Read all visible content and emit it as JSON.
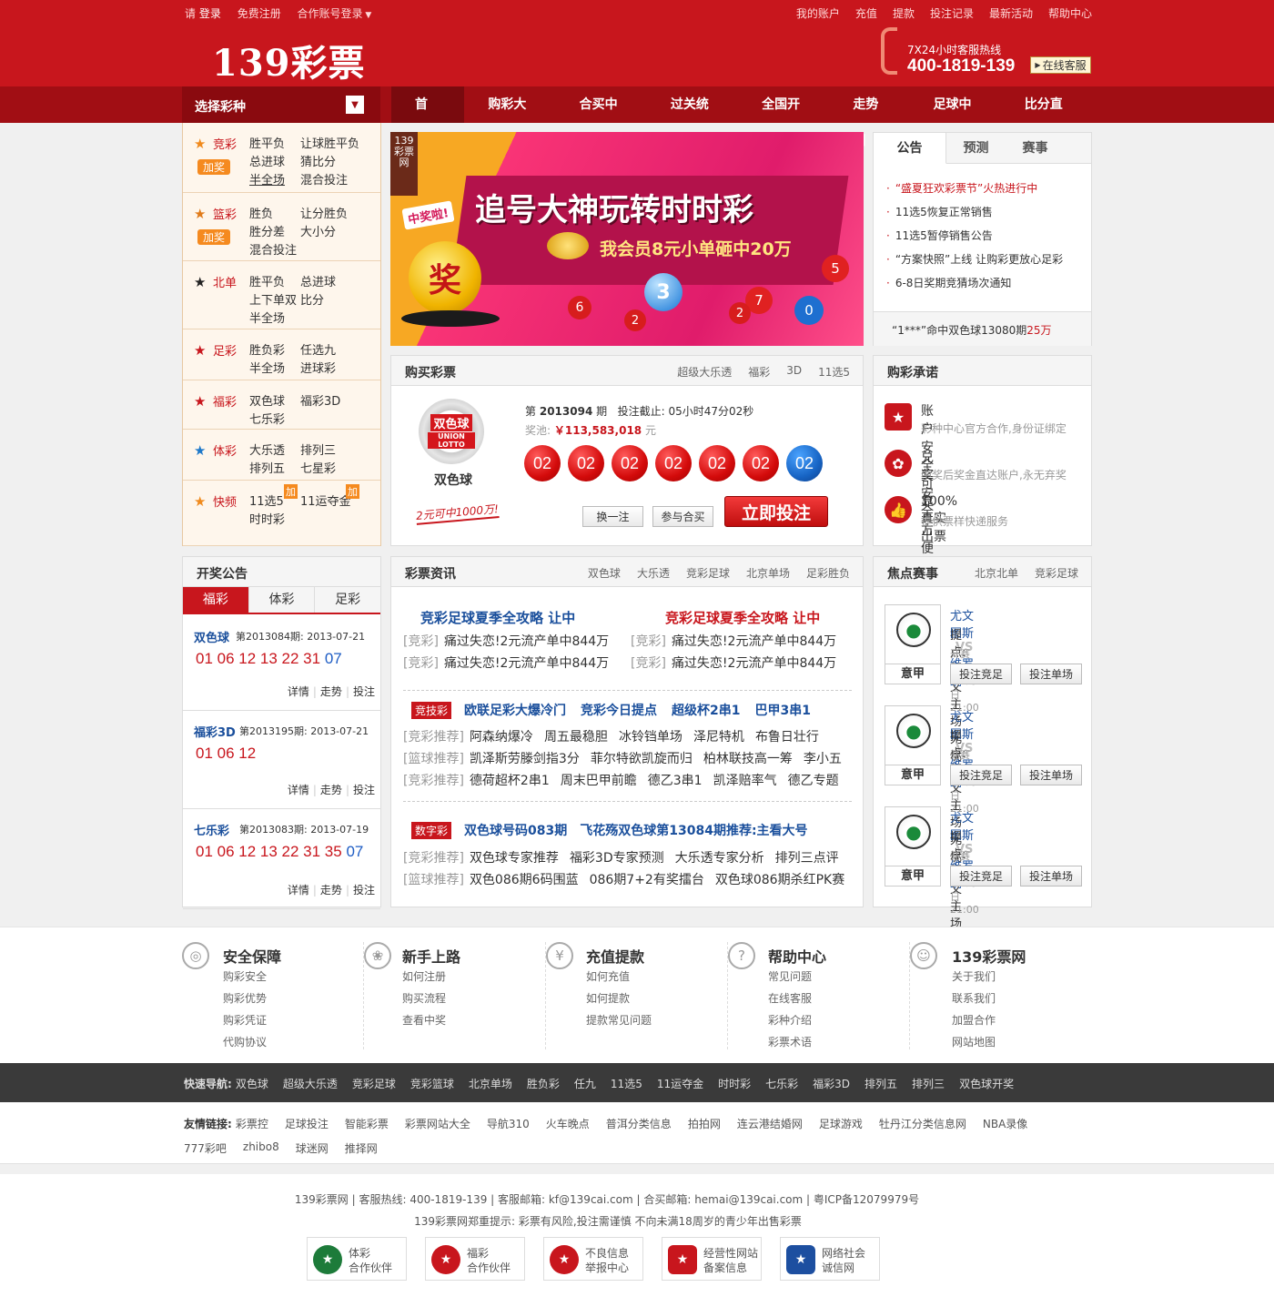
{
  "topbar": {
    "please": "请",
    "login": "登录",
    "register": "免费注册",
    "partner_login": "合作账号登录",
    "right_links": [
      "我的账户",
      "充值",
      "提款",
      "投注记录",
      "最新活动",
      "帮助中心"
    ]
  },
  "logo": "139彩票",
  "hotline": {
    "label": "7X24小时客服热线",
    "number": "400-1819-139",
    "online": "在线客服"
  },
  "nav": {
    "select": "选择彩种",
    "items": [
      "首 页",
      "购彩大厅",
      "合买中心",
      "过关统计",
      "全国开奖",
      "走势图",
      "足球中心",
      "比分直播"
    ]
  },
  "lottery_menu": [
    {
      "name": "竞彩",
      "badge": "加奖",
      "items": [
        "胜平负",
        "让球胜平负",
        "总进球",
        "猜比分",
        "半全场",
        "混合投注"
      ]
    },
    {
      "name": "篮彩",
      "badge": "加奖",
      "items": [
        "胜负",
        "让分胜负",
        "胜分差",
        "大小分",
        "混合投注"
      ]
    },
    {
      "name": "北单",
      "items": [
        "胜平负",
        "总进球",
        "上下单双",
        "比分",
        "半全场"
      ]
    },
    {
      "name": "足彩",
      "items": [
        "胜负彩",
        "任选九",
        "半全场",
        "进球彩"
      ]
    },
    {
      "name": "福彩",
      "items": [
        "双色球",
        "福彩3D",
        "七乐彩"
      ]
    },
    {
      "name": "体彩",
      "items": [
        "大乐透",
        "排列三",
        "排列五",
        "七星彩"
      ]
    },
    {
      "name": "快频",
      "items": [
        "11选5",
        "11运夺金",
        "时时彩"
      ],
      "jia": "加"
    }
  ],
  "banner": {
    "brand": "139彩票网",
    "title": "追号大神玩转时时彩",
    "subtitle": "我会员8元小单砸中20万",
    "tag": "中奖啦!",
    "award": "奖",
    "balls": [
      "6",
      "2",
      "3",
      "7",
      "2",
      "5",
      "0"
    ]
  },
  "notice": {
    "tabs": [
      "公告",
      "预测",
      "赛事"
    ],
    "items": [
      "“盛夏狂欢彩票节”火热进行中",
      "11选5恢复正常销售",
      "11选5暂停销售公告",
      "“方案快照”上线 让购彩更放心足彩",
      "6-8日奖期竞猜场次通知"
    ],
    "winner": "“1***”命中双色球13080期",
    "winner_amount": "25万"
  },
  "buy": {
    "title": "购买彩票",
    "tabs": [
      "超级大乐透",
      "福彩",
      "3D",
      "11选5"
    ],
    "game": "双色球",
    "game_logo": "双色球",
    "game_logo_en": "UNION LOTTO",
    "slogan": "2元可中1000万!",
    "issue_prefix": "第",
    "issue": "2013094",
    "issue_suffix": "期",
    "deadline": "投注截止: 05小时47分02秒",
    "pool_label": "奖池:",
    "pool": "￥113,583,018",
    "pool_unit": "元",
    "reds": [
      "02",
      "02",
      "02",
      "02",
      "02",
      "02"
    ],
    "blue": "02",
    "btn_change": "换一注",
    "btn_join": "参与合买",
    "btn_bet": "立即投注"
  },
  "promise": {
    "title": "购彩承诺",
    "items": [
      {
        "t": "账户安全可靠",
        "d": "彩种中心官方合作,身份证绑定"
      },
      {
        "t": "兑奖安全方便",
        "d": "中奖后奖金直达账户,永无弃奖"
      },
      {
        "t": "100%真实出票",
        "d": "提供票样快递服务"
      }
    ]
  },
  "draw": {
    "title": "开奖公告",
    "tabs": [
      "福彩",
      "体彩",
      "足彩"
    ],
    "items": [
      {
        "name": "双色球",
        "issue": "第2013084期: 2013-07-21",
        "reds": "01 06 12 13 22 31",
        "blue": "07"
      },
      {
        "name": "福彩3D",
        "issue": "第2013195期: 2013-07-21",
        "reds": "01 06 12",
        "blue": ""
      },
      {
        "name": "七乐彩",
        "issue": "第2013083期: 2013-07-19",
        "reds": "01 06 12 13 22 31 35",
        "blue": "07"
      }
    ],
    "links": [
      "详情",
      "走势",
      "投注"
    ]
  },
  "news": {
    "title": "彩票资讯",
    "tabs": [
      "双色球",
      "大乐透",
      "竞彩足球",
      "北京单场",
      "足彩胜负"
    ],
    "head1": "竞彩足球夏季全攻略 让中",
    "head2": "竞彩足球夏季全攻略 让中",
    "tag": "[竞彩]",
    "line": "痛过失恋!2元流产单中844万",
    "sec2_label": "竞技彩",
    "sec2_heads": [
      "欧联足彩大爆冷门",
      "竞彩今日提点",
      "超级杯2串1",
      "巴甲3串1"
    ],
    "sec2_rows": [
      {
        "tag": "[竞彩推荐]",
        "items": [
          "阿森纳爆冷",
          "周五最稳胆",
          "冰铃铛单场",
          "泽尼特机",
          "布鲁日壮行"
        ]
      },
      {
        "tag": "[篮球推荐]",
        "items": [
          "凯泽斯劳滕剑指3分",
          "菲尔特欲凯旋而归",
          "柏林联技高一筹",
          "李小五"
        ]
      },
      {
        "tag": "[竞彩推荐]",
        "items": [
          "德荷超杯2串1",
          "周末巴甲前瞻",
          "德乙3串1",
          "凯泽赔率气",
          "德乙专题"
        ]
      }
    ],
    "sec3_label": "数字彩",
    "sec3_heads": [
      "双色球号码083期",
      "飞花殇双色球第13084期推荐:主看大号"
    ],
    "sec3_rows": [
      {
        "tag": "[竞彩推荐]",
        "items": [
          "双色球专家推荐",
          "福彩3D专家预测",
          "大乐透专家分析",
          "排列三点评"
        ]
      },
      {
        "tag": "[篮球推荐]",
        "items": [
          "双色086期6码围蓝",
          "086期7+2有奖擂台",
          "双色球086期杀红PK赛"
        ]
      }
    ]
  },
  "focus": {
    "title": "焦点赛事",
    "tabs": [
      "北京北单",
      "竞彩足球"
    ],
    "matches": [
      {
        "home": "尤文图斯",
        "vs": "VS",
        "away": "维罗纳",
        "tip": "提点: 尤文主场无忧",
        "time": "开赛 09-22 周日 21:00",
        "league": "意甲",
        "b1": "投注竞足",
        "b2": "投注单场"
      },
      {
        "home": "尤文图斯",
        "vs": "VS",
        "away": "维罗纳",
        "tip": "提点: 尤文主场无忧",
        "time": "开赛 09-22 周日 21:00",
        "league": "意甲",
        "b1": "投注竞足",
        "b2": "投注单场"
      },
      {
        "home": "尤文图斯",
        "vs": "VS",
        "away": "维罗纳",
        "tip": "提点: 尤文主场无忧",
        "time": "开赛 09-22 周日 21:00",
        "league": "意甲",
        "b1": "投注竞足",
        "b2": "投注单场"
      }
    ]
  },
  "help": [
    {
      "t": "安全保障",
      "i": [
        "购彩安全",
        "购彩优势",
        "购彩凭证",
        "代购协议"
      ]
    },
    {
      "t": "新手上路",
      "i": [
        "如何注册",
        "购买流程",
        "查看中奖"
      ]
    },
    {
      "t": "充值提款",
      "i": [
        "如何充值",
        "如何提款",
        "提款常见问题"
      ]
    },
    {
      "t": "帮助中心",
      "i": [
        "常见问题",
        "在线客服",
        "彩种介绍",
        "彩票术语"
      ]
    },
    {
      "t": "139彩票网",
      "i": [
        "关于我们",
        "联系我们",
        "加盟合作",
        "网站地图"
      ]
    }
  ],
  "quick": {
    "label": "快速导航:",
    "items": [
      "双色球",
      "超级大乐透",
      "竞彩足球",
      "竞彩篮球",
      "北京单场",
      "胜负彩",
      "任九",
      "11选5",
      "11运夺金",
      "时时彩",
      "七乐彩",
      "福彩3D",
      "排列五",
      "排列三",
      "双色球开奖"
    ]
  },
  "friends": {
    "label": "友情链接:",
    "items": [
      "彩票控",
      "足球投注",
      "智能彩票",
      "彩票网站大全",
      "导航310",
      "火车晚点",
      "普洱分类信息",
      "拍拍网",
      "连云港结婚网",
      "足球游戏",
      "牡丹江分类信息网",
      "NBA录像",
      "777彩吧",
      "zhibo8",
      "球迷网",
      "推择网"
    ]
  },
  "footer": {
    "line1": "139彩票网 | 客服热线: 400-1819-139 | 客服邮箱: kf@139cai.com | 合买邮箱: hemai@139cai.com | 粤ICP备12079979号",
    "line2": "139彩票网郑重提示: 彩票有风险,投注需谨慎 不向未满18周岁的青少年出售彩票",
    "badges": [
      [
        "体彩",
        "合作伙伴"
      ],
      [
        "福彩",
        "合作伙伴"
      ],
      [
        "不良信息",
        "举报中心"
      ],
      [
        "经营性网站",
        "备案信息"
      ],
      [
        "网络社会",
        "诚信网"
      ]
    ]
  }
}
